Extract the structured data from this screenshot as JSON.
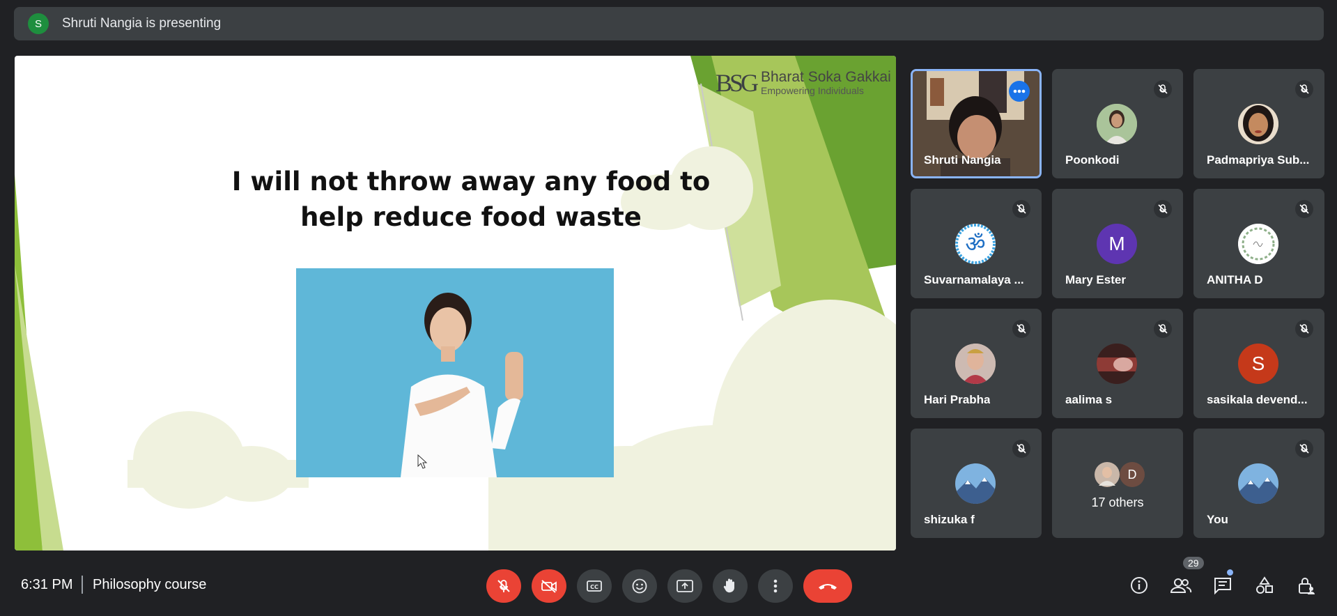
{
  "presenting_bar": {
    "avatar_letter": "S",
    "text": "Shruti Nangia is presenting"
  },
  "slide": {
    "logo_title": "Bharat Soka Gakkai",
    "logo_subtitle": "Empowering Individuals",
    "logo_mark": "BSG",
    "title": "I will not throw away any food to help reduce food waste",
    "colors": {
      "green_dark": "#6aa231",
      "green_light": "#c7dc8f",
      "cream": "#f0f2df"
    }
  },
  "participants": [
    {
      "name": "Shruti Nangia",
      "type": "video",
      "active": true,
      "muted": false
    },
    {
      "name": "Poonkodi",
      "type": "photo",
      "muted": true
    },
    {
      "name": "Padmapriya Sub...",
      "type": "photo",
      "muted": true
    },
    {
      "name": "Suvarnamalaya ...",
      "type": "om-icon",
      "muted": true
    },
    {
      "name": "Mary Ester",
      "type": "letter",
      "letter": "M",
      "color": "#5e35b1",
      "muted": true
    },
    {
      "name": "ANITHA D",
      "type": "photo",
      "muted": true
    },
    {
      "name": "Hari Prabha",
      "type": "photo",
      "muted": true
    },
    {
      "name": "aalima s",
      "type": "photo",
      "muted": true
    },
    {
      "name": "sasikala devend...",
      "type": "letter",
      "letter": "S",
      "color": "#c5391a",
      "muted": true
    },
    {
      "name": "shizuka f",
      "type": "photo",
      "muted": true
    },
    {
      "name": "You",
      "type": "photo",
      "muted": true
    }
  ],
  "others_tile": {
    "label": "17 others",
    "letter": "D"
  },
  "bottom_bar": {
    "time": "6:31 PM",
    "meeting_name": "Philosophy course",
    "people_count": "29"
  }
}
